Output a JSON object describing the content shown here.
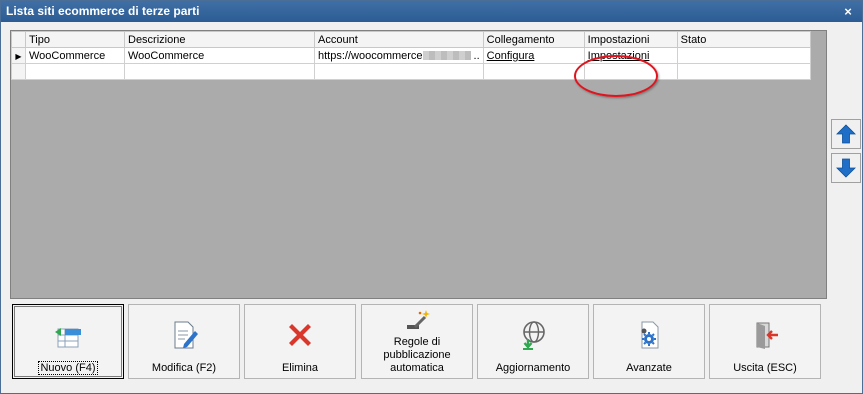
{
  "window": {
    "title": "Lista siti ecommerce di terze parti",
    "close_glyph": "×"
  },
  "grid": {
    "columns": [
      "Tipo",
      "Descrizione",
      "Account",
      "Collegamento",
      "Impostazioni",
      "Stato"
    ],
    "rows": [
      {
        "tipo": "WooCommerce",
        "descrizione": "WooCommerce",
        "account": "https://woocommerce",
        "account_suffix": "..",
        "collegamento": "Configura",
        "impostazioni": "Impostazioni",
        "stato": ""
      }
    ]
  },
  "side": {
    "up_icon": "arrow-up-icon",
    "down_icon": "arrow-down-icon"
  },
  "toolbar": {
    "buttons": [
      {
        "label": "Nuovo (F4)"
      },
      {
        "label": "Modifica (F2)"
      },
      {
        "label": "Elimina"
      },
      {
        "label": "Regole di pubblicazione automatica"
      },
      {
        "label": "Aggiornamento"
      },
      {
        "label": "Avanzate"
      },
      {
        "label": "Uscita (ESC)"
      }
    ]
  },
  "colors": {
    "title_bar": "#2f62a0",
    "annotation": "#e0141e",
    "arrow_blue": "#1f6fc8",
    "delete_red": "#d9372b"
  }
}
